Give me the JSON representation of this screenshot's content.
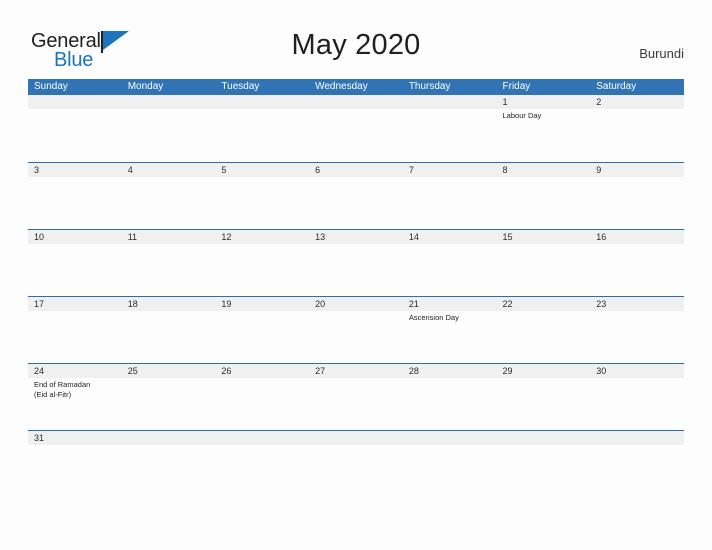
{
  "header": {
    "logo_primary": "General",
    "logo_secondary": "Blue",
    "logo_flag_icon": "blue-flag-triangle",
    "title": "May 2020",
    "country": "Burundi"
  },
  "colors": {
    "header_blue": "#3074b5",
    "row_divider_blue": "#2e6da8",
    "daynum_band_gray": "#f0f0f0",
    "logo_blue": "#1b75bc",
    "text_dark": "#231f20",
    "page_background": "#fdfdfd"
  },
  "calendar": {
    "weekday_headers": [
      "Sunday",
      "Monday",
      "Tuesday",
      "Wednesday",
      "Thursday",
      "Friday",
      "Saturday"
    ],
    "weeks": [
      {
        "days": [
          {
            "num": "",
            "events": []
          },
          {
            "num": "",
            "events": []
          },
          {
            "num": "",
            "events": []
          },
          {
            "num": "",
            "events": []
          },
          {
            "num": "",
            "events": []
          },
          {
            "num": "1",
            "events": [
              "Labour Day"
            ]
          },
          {
            "num": "2",
            "events": []
          }
        ]
      },
      {
        "days": [
          {
            "num": "3",
            "events": []
          },
          {
            "num": "4",
            "events": []
          },
          {
            "num": "5",
            "events": []
          },
          {
            "num": "6",
            "events": []
          },
          {
            "num": "7",
            "events": []
          },
          {
            "num": "8",
            "events": []
          },
          {
            "num": "9",
            "events": []
          }
        ]
      },
      {
        "days": [
          {
            "num": "10",
            "events": []
          },
          {
            "num": "11",
            "events": []
          },
          {
            "num": "12",
            "events": []
          },
          {
            "num": "13",
            "events": []
          },
          {
            "num": "14",
            "events": []
          },
          {
            "num": "15",
            "events": []
          },
          {
            "num": "16",
            "events": []
          }
        ]
      },
      {
        "days": [
          {
            "num": "17",
            "events": []
          },
          {
            "num": "18",
            "events": []
          },
          {
            "num": "19",
            "events": []
          },
          {
            "num": "20",
            "events": []
          },
          {
            "num": "21",
            "events": [
              "Ascension Day"
            ]
          },
          {
            "num": "22",
            "events": []
          },
          {
            "num": "23",
            "events": []
          }
        ]
      },
      {
        "days": [
          {
            "num": "24",
            "events": [
              "End of Ramadan\n(Eid al-Fitr)"
            ]
          },
          {
            "num": "25",
            "events": []
          },
          {
            "num": "26",
            "events": []
          },
          {
            "num": "27",
            "events": []
          },
          {
            "num": "28",
            "events": []
          },
          {
            "num": "29",
            "events": []
          },
          {
            "num": "30",
            "events": []
          }
        ]
      },
      {
        "days": [
          {
            "num": "31",
            "events": []
          },
          {
            "num": "",
            "events": []
          },
          {
            "num": "",
            "events": []
          },
          {
            "num": "",
            "events": []
          },
          {
            "num": "",
            "events": []
          },
          {
            "num": "",
            "events": []
          },
          {
            "num": "",
            "events": []
          }
        ]
      }
    ]
  }
}
